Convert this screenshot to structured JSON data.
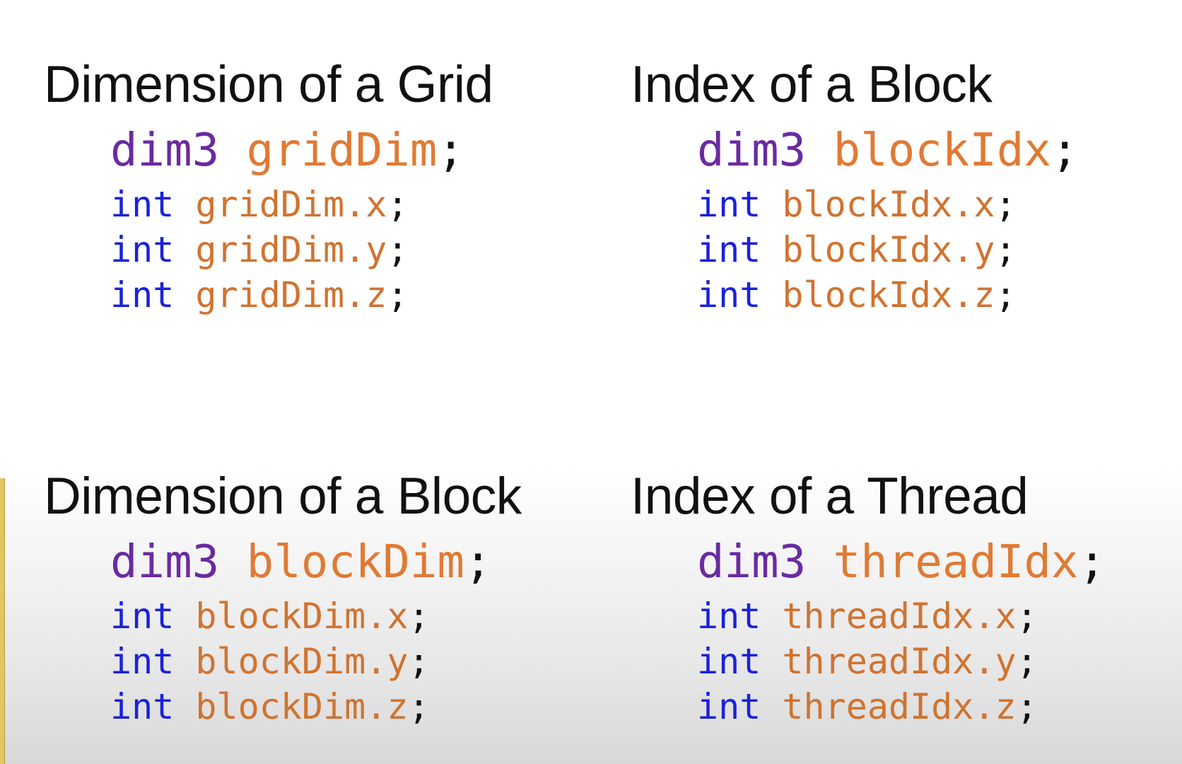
{
  "colors": {
    "dim3_keyword": "#6a2aa0",
    "int_keyword": "#1a22d9",
    "identifier": "#e07a34",
    "text": "#111111",
    "edge_bar": "#e2c75f"
  },
  "sections": [
    {
      "heading": "Dimension of a Grid",
      "decl_type": "dim3",
      "decl_name": "gridDim",
      "decl_end": ";",
      "fields": [
        {
          "type": "int",
          "name": "gridDim.x",
          "end": ";"
        },
        {
          "type": "int",
          "name": "gridDim.y",
          "end": ";"
        },
        {
          "type": "int",
          "name": "gridDim.z",
          "end": ";"
        }
      ]
    },
    {
      "heading": "Index of a Block",
      "decl_type": "dim3",
      "decl_name": "blockIdx",
      "decl_end": ";",
      "fields": [
        {
          "type": "int",
          "name": "blockIdx.x",
          "end": ";"
        },
        {
          "type": "int",
          "name": "blockIdx.y",
          "end": ";"
        },
        {
          "type": "int",
          "name": "blockIdx.z",
          "end": ";"
        }
      ]
    },
    {
      "heading": "Dimension of a Block",
      "decl_type": "dim3",
      "decl_name": "blockDim",
      "decl_end": ";",
      "fields": [
        {
          "type": "int",
          "name": "blockDim.x",
          "end": ";"
        },
        {
          "type": "int",
          "name": "blockDim.y",
          "end": ";"
        },
        {
          "type": "int",
          "name": "blockDim.z",
          "end": ";"
        }
      ]
    },
    {
      "heading": "Index of a Thread",
      "decl_type": "dim3",
      "decl_name": "threadIdx",
      "decl_end": ";",
      "fields": [
        {
          "type": "int",
          "name": "threadIdx.x",
          "end": ";"
        },
        {
          "type": "int",
          "name": "threadIdx.y",
          "end": ";"
        },
        {
          "type": "int",
          "name": "threadIdx.z",
          "end": ";"
        }
      ]
    }
  ]
}
